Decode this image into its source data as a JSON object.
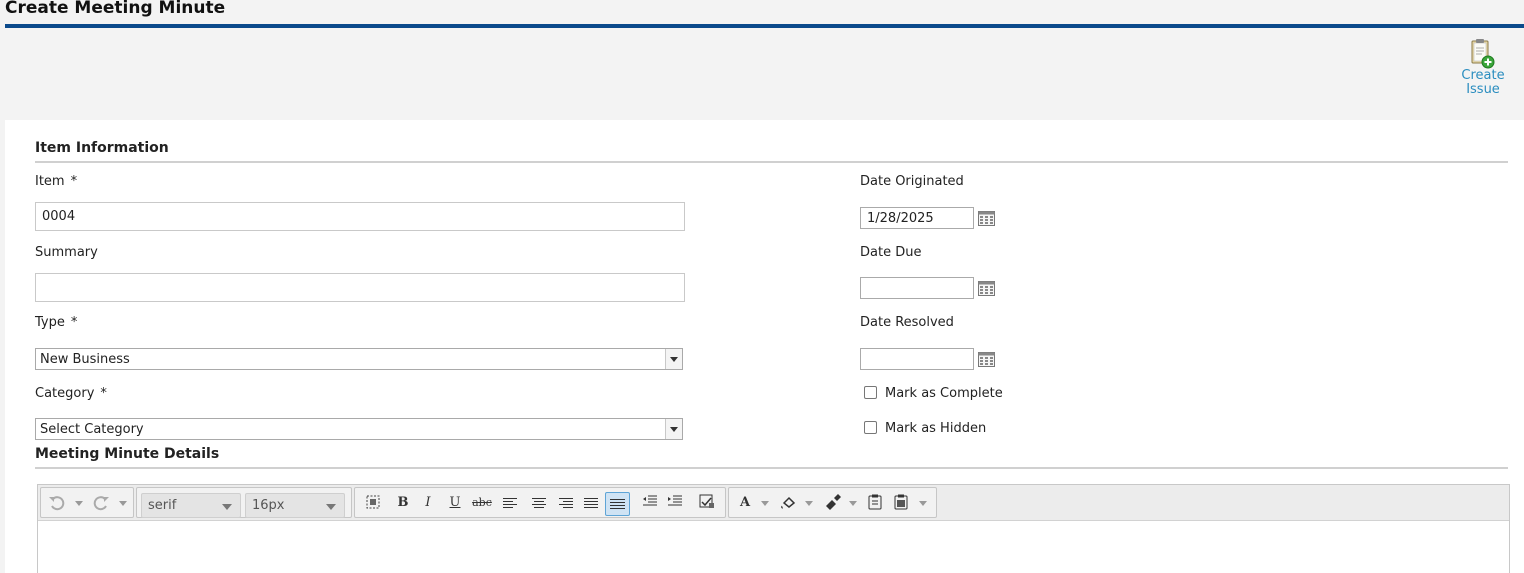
{
  "page": {
    "title": "Create Meeting Minute"
  },
  "actions": {
    "create_issue": "Create\nIssue",
    "create_issue_line1": "Create",
    "create_issue_line2": "Issue"
  },
  "sections": {
    "item_info": "Item Information",
    "details": "Meeting Minute Details"
  },
  "fields": {
    "item": {
      "label": "Item",
      "required": "*",
      "value": "0004"
    },
    "summary": {
      "label": "Summary",
      "value": ""
    },
    "type": {
      "label": "Type",
      "required": "*",
      "value": "New Business"
    },
    "category": {
      "label": "Category",
      "required": "*",
      "value": "Select Category"
    },
    "date_originated": {
      "label": "Date Originated",
      "value": "1/28/2025"
    },
    "date_due": {
      "label": "Date Due",
      "value": ""
    },
    "date_resolved": {
      "label": "Date Resolved",
      "value": ""
    },
    "mark_complete": {
      "label": "Mark as Complete",
      "checked": false
    },
    "mark_hidden": {
      "label": "Mark as Hidden",
      "checked": false
    }
  },
  "editor": {
    "font_family": "serif",
    "font_size": "16px",
    "buttons": {
      "bold": "B",
      "italic": "I",
      "underline": "U",
      "strike": "abc",
      "font_color": "A"
    }
  },
  "colors": {
    "title_rule": "#0b4a8b",
    "link": "#2a8dbf"
  },
  "icons": [
    "clipboard-add-icon",
    "calendar-icon",
    "undo-icon",
    "redo-icon",
    "bold-icon",
    "italic-icon",
    "underline-icon",
    "strikethrough-icon",
    "align-left-icon",
    "align-center-icon",
    "align-right-icon",
    "justify-icon",
    "outdent-icon",
    "indent-icon",
    "font-color-icon",
    "highlight-icon",
    "format-painter-icon",
    "paste-icon",
    "paste-text-icon"
  ]
}
